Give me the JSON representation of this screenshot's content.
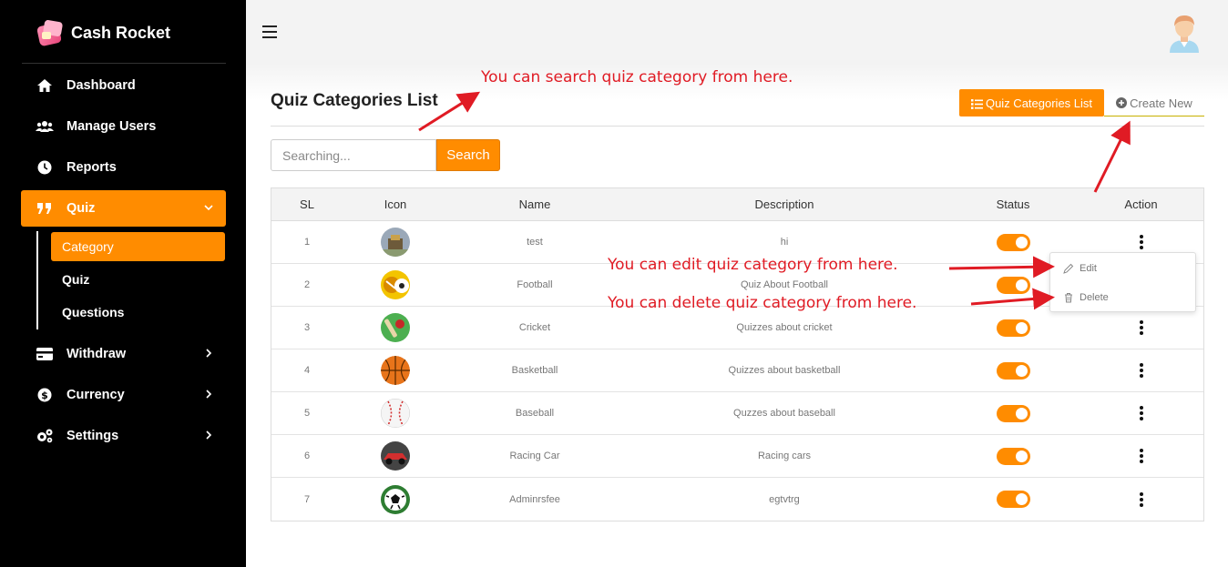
{
  "app": {
    "name": "Cash Rocket"
  },
  "sidebar": {
    "items": [
      {
        "label": "Dashboard",
        "icon": "home-icon"
      },
      {
        "label": "Manage Users",
        "icon": "users-icon"
      },
      {
        "label": "Reports",
        "icon": "clock-icon"
      },
      {
        "label": "Quiz",
        "icon": "quote-icon"
      },
      {
        "label": "Withdraw",
        "icon": "credit-card-icon"
      },
      {
        "label": "Currency",
        "icon": "dollar-icon"
      },
      {
        "label": "Settings",
        "icon": "cogs-icon"
      }
    ],
    "quiz_submenu": [
      {
        "label": "Category"
      },
      {
        "label": "Quiz"
      },
      {
        "label": "Questions"
      }
    ]
  },
  "main": {
    "title": "Quiz Categories List",
    "tabs": [
      {
        "label": "Quiz Categories List",
        "icon": "list-icon",
        "active": true
      },
      {
        "label": "Create New",
        "icon": "plus-circle-icon",
        "active": false
      }
    ],
    "search": {
      "placeholder": "Searching...",
      "value": "",
      "button_label": "Search"
    },
    "table": {
      "columns": [
        "SL",
        "Icon",
        "Name",
        "Description",
        "Status",
        "Action"
      ],
      "rows": [
        {
          "sl": "1",
          "name": "test",
          "description": "hi",
          "status": true
        },
        {
          "sl": "2",
          "name": "Football",
          "description": "Quiz About Football",
          "status": true
        },
        {
          "sl": "3",
          "name": "Cricket",
          "description": "Quizzes about cricket",
          "status": true
        },
        {
          "sl": "4",
          "name": "Basketball",
          "description": "Quizzes about basketball",
          "status": true
        },
        {
          "sl": "5",
          "name": "Baseball",
          "description": "Quzzes about baseball",
          "status": true
        },
        {
          "sl": "6",
          "name": "Racing Car",
          "description": "Racing cars",
          "status": true
        },
        {
          "sl": "7",
          "name": "Adminrsfee",
          "description": "egtvtrg",
          "status": true
        }
      ]
    },
    "action_menu": {
      "items": [
        {
          "label": "Edit",
          "icon": "pencil-icon"
        },
        {
          "label": "Delete",
          "icon": "trash-icon"
        }
      ]
    }
  },
  "annotations": {
    "search": "You can search quiz category from here.",
    "edit": "You can edit quiz category from here.",
    "delete": "You can delete quiz category from here."
  },
  "colors": {
    "accent": "#ff8c00",
    "sidebar_bg": "#000000",
    "annotation": "#e01b24"
  }
}
